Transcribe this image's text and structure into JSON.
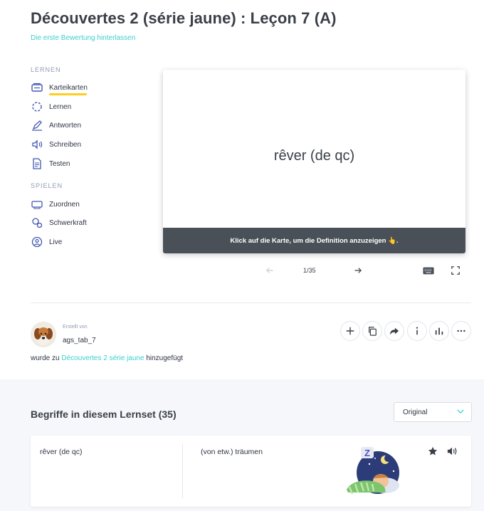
{
  "set": {
    "title": "Découvertes 2 (série jaune) : Leçon 7 (A)",
    "rating_link": "Die erste Bewertung hinterlassen"
  },
  "sidebar": {
    "learn_label": "LERNEN",
    "learn_items": [
      {
        "label": "Karteikarten",
        "icon": "flashcards-icon",
        "active": true
      },
      {
        "label": "Lernen",
        "icon": "learn-cycle-icon"
      },
      {
        "label": "Antworten",
        "icon": "pen-icon"
      },
      {
        "label": "Schreiben",
        "icon": "speaker-write-icon"
      },
      {
        "label": "Testen",
        "icon": "document-icon"
      }
    ],
    "play_label": "SPIELEN",
    "play_items": [
      {
        "label": "Zuordnen",
        "icon": "match-icon"
      },
      {
        "label": "Schwerkraft",
        "icon": "gravity-icon"
      },
      {
        "label": "Live",
        "icon": "live-icon"
      }
    ]
  },
  "flashcard": {
    "term": "rêver (de qc)",
    "hint": "Klick auf die Karte, um die Definition anzuzeigen 👆.",
    "counter": "1/35"
  },
  "creator": {
    "label": "Erstellt von",
    "username": "ags_tab_7",
    "added_prefix": "wurde zu",
    "added_folder": "Découvertes 2 série jaune",
    "added_suffix": "hinzugefügt"
  },
  "terms_section": {
    "heading": "Begriffe in diesem Lernset (35)",
    "sort_selected": "Original",
    "rows": [
      {
        "term": "rêver (de qc)",
        "definition": "(von etw.) träumen"
      }
    ]
  },
  "colors": {
    "accent": "#3ccfcf",
    "active_underline": "#ffcd1f",
    "card_footer": "#4a5058"
  }
}
